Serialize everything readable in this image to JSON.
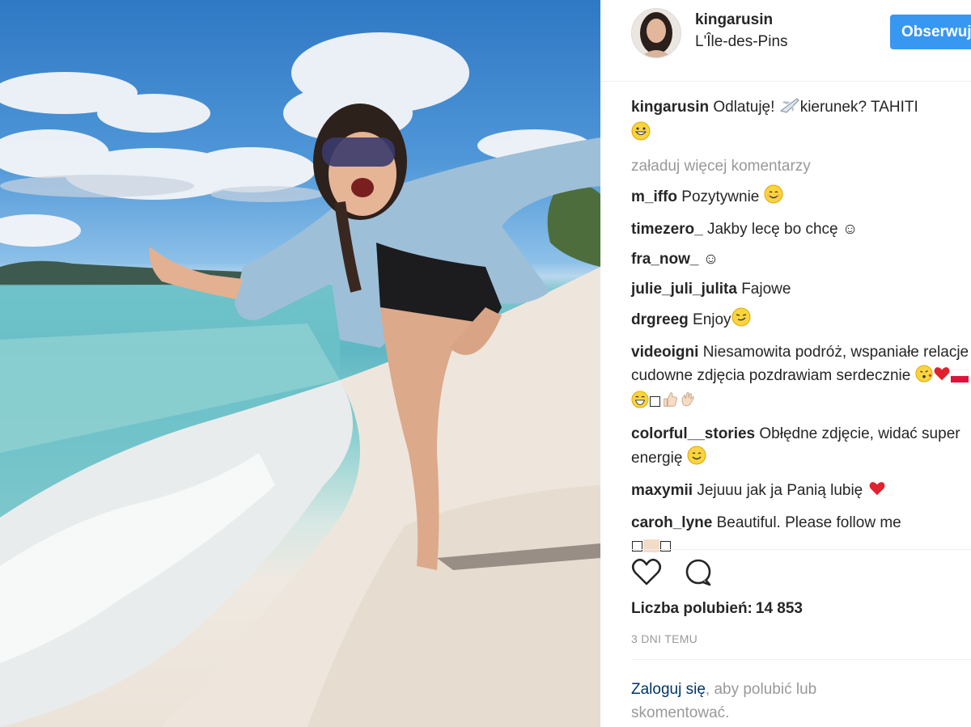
{
  "photo": {
    "alt_icon": "beach-photo"
  },
  "header": {
    "username": "kingarusin",
    "location": "L'Île-des-Pins",
    "follow_label": "Obserwuj"
  },
  "caption": {
    "username": "kingarusin",
    "text_part1": "Odlatuję! ",
    "text_part2": "kierunek? TAHITI"
  },
  "load_more": "załaduj więcej komentarzy",
  "comments": [
    {
      "user": "m_iffo",
      "text": "Pozytywnie"
    },
    {
      "user": "timezero_",
      "text": "Jakby lecę bo chcę ☺"
    },
    {
      "user": "fra_now_",
      "text": "☺"
    },
    {
      "user": "julie_juli_julita",
      "text": "Fajowe"
    },
    {
      "user": "drgreeg",
      "text": "Enjoy"
    },
    {
      "user": "videoigni",
      "text": "Niesamowita podróż, wspaniałe relacje i cudowne zdjęcia pozdrawiam serdecznie"
    },
    {
      "user": "colorful__stories",
      "text": "Obłędne zdjęcie, widać super energię"
    },
    {
      "user": "maxymii",
      "text": "Jejuuu jak ja Panią lubię"
    },
    {
      "user": "caroh_lyne",
      "text": "Beautiful. Please follow me"
    }
  ],
  "likes": {
    "label": "Liczba polubień:",
    "count": "14 853"
  },
  "time": "3 DNI TEMU",
  "login": {
    "link": "Zaloguj się",
    "rest": ", aby polubić lub skomentować."
  },
  "colors": {
    "accent": "#3897f0",
    "link": "#003569",
    "muted": "#999999"
  }
}
